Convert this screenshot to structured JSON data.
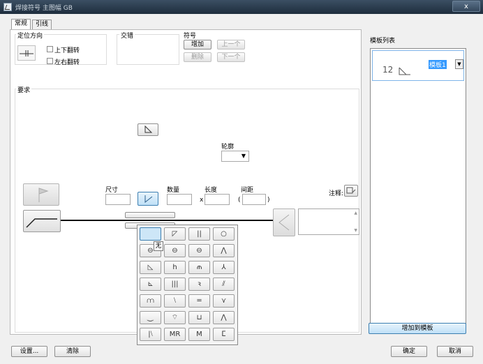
{
  "window": {
    "title": "焊接符号 主图幅 GB",
    "close": "x"
  },
  "tabs": [
    {
      "label": "常规"
    },
    {
      "label": "引线"
    }
  ],
  "orientation": {
    "label": "定位方向",
    "flip_v": "上下翻转",
    "flip_h": "左右翻转"
  },
  "stagger": {
    "label": "交错"
  },
  "symbol": {
    "label": "符号",
    "add": "增加",
    "prev": "上一个",
    "delete": "删除",
    "next": "下一个"
  },
  "requirements": {
    "label": "要求"
  },
  "profile": {
    "label": "轮廓"
  },
  "fields": {
    "size": "尺寸",
    "count": "数量",
    "length": "长度",
    "pitch": "间距",
    "x_sep": "x",
    "paren_open": "(",
    "paren_close": ")",
    "note": "注释:"
  },
  "palette": {
    "tooltip": "无",
    "rows": [
      [
        "",
        "◸",
        "||",
        "○"
      ],
      [
        "⊖",
        "⊖",
        "⊖",
        "⋀"
      ],
      [
        "◺",
        "h",
        "⫙",
        "⅄"
      ],
      [
        "⊾",
        "|||",
        "ꝛ",
        "⫽"
      ],
      [
        "⩋",
        "⧵",
        "═",
        "⋎"
      ],
      [
        "⏝",
        "⌔",
        "⊔",
        "⋀"
      ],
      [
        "|⧵",
        "MR",
        "M",
        "ⵎ"
      ]
    ]
  },
  "template_list": {
    "label": "模板列表",
    "item_value": "12",
    "item_name": "模板1",
    "add": "增加到模板"
  },
  "footer": {
    "settings": "设置...",
    "clear": "清除",
    "ok": "确定",
    "cancel": "取消"
  }
}
